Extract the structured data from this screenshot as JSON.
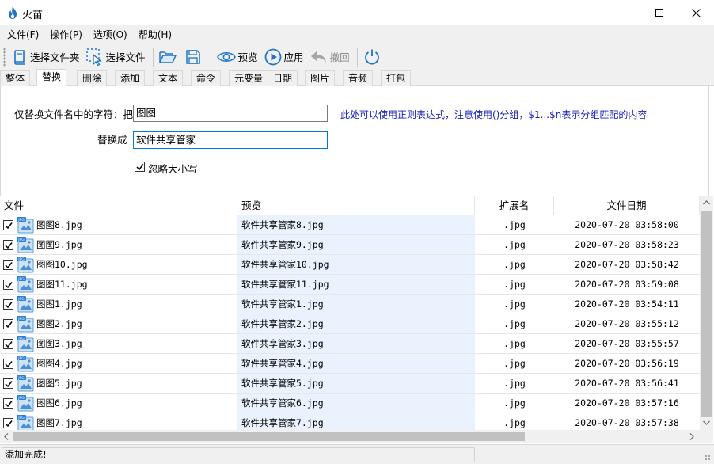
{
  "window": {
    "title": "火苗"
  },
  "menu": [
    "文件(F)",
    "操作(P)",
    "选项(O)",
    "帮助(H)"
  ],
  "toolbar": {
    "select_folder": "选择文件夹",
    "select_file": "选择文件",
    "preview": "预览",
    "apply": "应用",
    "undo": "撤回"
  },
  "tabs": [
    "整体",
    "替换",
    "删除",
    "添加",
    "文本",
    "命令",
    "元变量",
    "日期",
    "图片",
    "音频",
    "打包"
  ],
  "active_tab": "替换",
  "replace_panel": {
    "find_label": "仅替换文件名中的字符：把",
    "find_value": "图图",
    "replace_label": "替换成",
    "replace_value": "软件共享管家",
    "hint": "此处可以使用正则表达式，注意使用()分组，$1...$n表示分组匹配的内容",
    "ignore_case_label": "忽略大小写",
    "ignore_case_checked": true
  },
  "columns": {
    "file": "文件",
    "preview": "预览",
    "ext": "扩展名",
    "date": "文件日期"
  },
  "rows": [
    {
      "name": "图图8.jpg",
      "preview": "软件共享管家8.jpg",
      "ext": ".jpg",
      "date": "2020-07-20 03:58:00"
    },
    {
      "name": "图图9.jpg",
      "preview": "软件共享管家9.jpg",
      "ext": ".jpg",
      "date": "2020-07-20 03:58:23"
    },
    {
      "name": "图图10.jpg",
      "preview": "软件共享管家10.jpg",
      "ext": ".jpg",
      "date": "2020-07-20 03:58:42"
    },
    {
      "name": "图图11.jpg",
      "preview": "软件共享管家11.jpg",
      "ext": ".jpg",
      "date": "2020-07-20 03:59:08"
    },
    {
      "name": "图图1.jpg",
      "preview": "软件共享管家1.jpg",
      "ext": ".jpg",
      "date": "2020-07-20 03:54:11"
    },
    {
      "name": "图图2.jpg",
      "preview": "软件共享管家2.jpg",
      "ext": ".jpg",
      "date": "2020-07-20 03:55:12"
    },
    {
      "name": "图图3.jpg",
      "preview": "软件共享管家3.jpg",
      "ext": ".jpg",
      "date": "2020-07-20 03:55:57"
    },
    {
      "name": "图图4.jpg",
      "preview": "软件共享管家4.jpg",
      "ext": ".jpg",
      "date": "2020-07-20 03:56:19"
    },
    {
      "name": "图图5.jpg",
      "preview": "软件共享管家5.jpg",
      "ext": ".jpg",
      "date": "2020-07-20 03:56:41"
    },
    {
      "name": "图图6.jpg",
      "preview": "软件共享管家6.jpg",
      "ext": ".jpg",
      "date": "2020-07-20 03:57:16"
    },
    {
      "name": "图图7.jpg",
      "preview": "软件共享管家7.jpg",
      "ext": ".jpg",
      "date": "2020-07-20 03:57:38"
    }
  ],
  "status": {
    "text": "添加完成!"
  },
  "colors": {
    "accent": "#0078d7",
    "hint_text": "#1a20b8",
    "preview_column": "#eaf3fd",
    "icon_blue": "#1e74c6"
  }
}
